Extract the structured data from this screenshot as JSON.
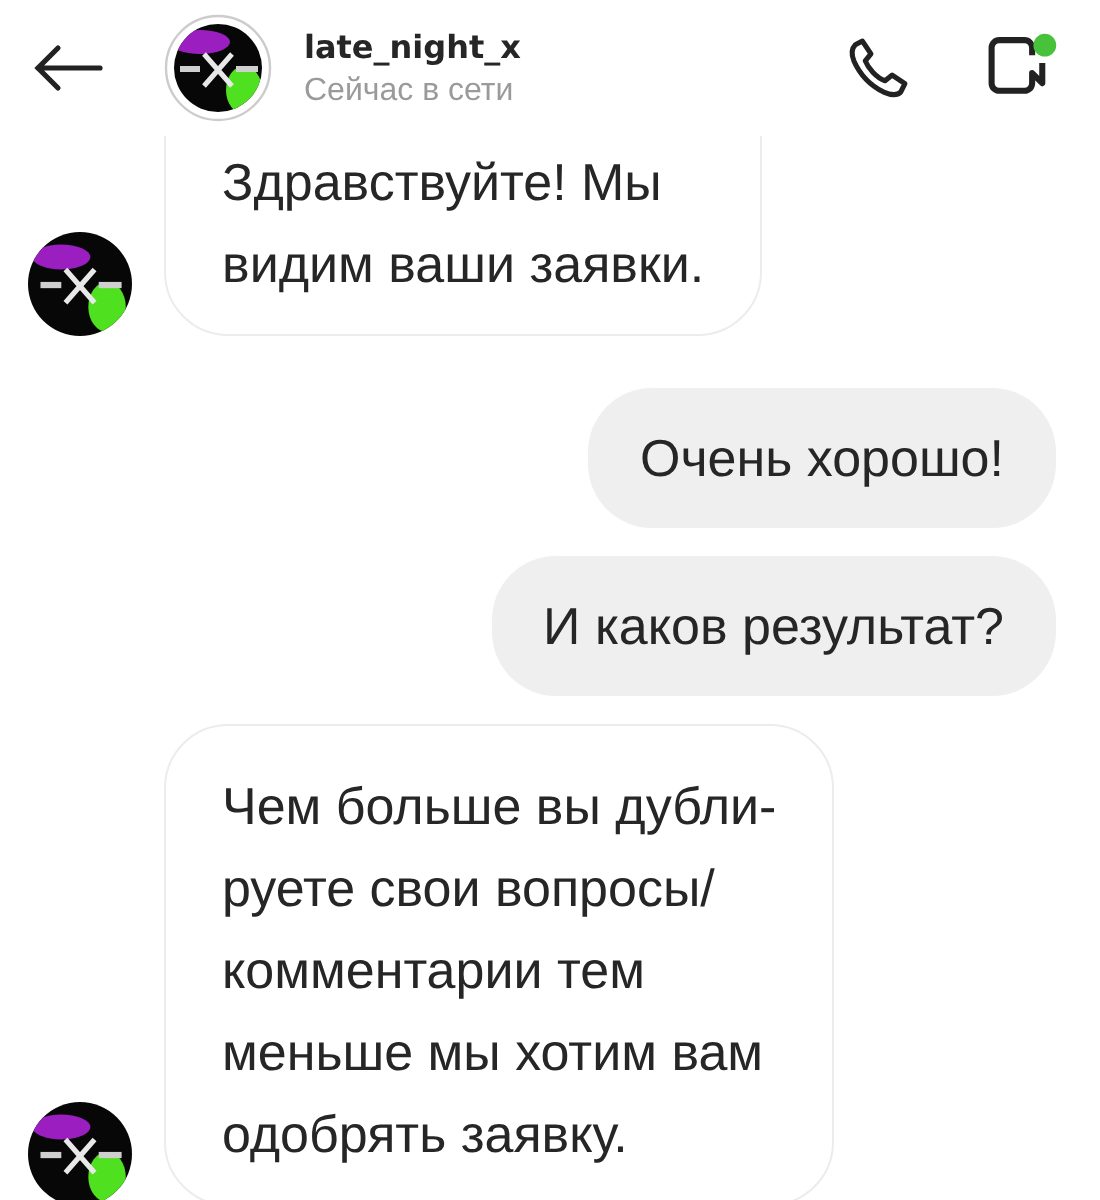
{
  "header": {
    "username": "late_night_x",
    "status": "Сейчас в сети",
    "video_online": true
  },
  "messages": [
    {
      "kind": "incoming",
      "lines": [
        "Здравствуйте! Мы",
        "видим ваши заявки."
      ]
    },
    {
      "kind": "outgoing",
      "lines": [
        "Очень хорошо!"
      ]
    },
    {
      "kind": "outgoing",
      "lines": [
        "И каков результат?"
      ]
    },
    {
      "kind": "incoming",
      "lines": [
        "Чем больше вы дубли-",
        "руете свои вопросы/",
        "комментарии тем",
        "меньше мы хотим вам",
        "одобрять заявку."
      ]
    }
  ]
}
